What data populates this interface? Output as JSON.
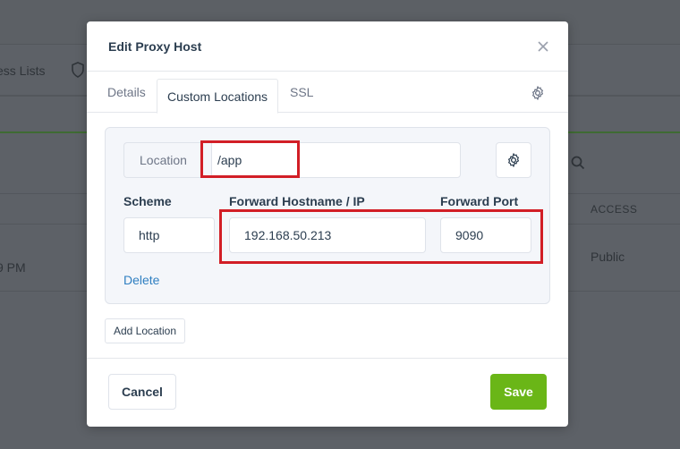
{
  "background": {
    "nav_text": "ess Lists",
    "access_header": "ACCESS",
    "access_value": "Public",
    "time_fragment": "9 PM"
  },
  "modal": {
    "title": "Edit Proxy Host",
    "tabs": [
      {
        "label": "Details"
      },
      {
        "label": "Custom Locations",
        "active": true
      },
      {
        "label": "SSL"
      }
    ],
    "location": {
      "prefix_label": "Location",
      "value": "/app"
    },
    "scheme": {
      "label": "Scheme",
      "value": "http"
    },
    "forward_host": {
      "label": "Forward Hostname / IP",
      "value": "192.168.50.213"
    },
    "forward_port": {
      "label": "Forward Port",
      "value": "9090"
    },
    "delete_label": "Delete",
    "add_location_label": "Add Location",
    "cancel_label": "Cancel",
    "save_label": "Save"
  },
  "colors": {
    "save_green": "#6ab617",
    "link_blue": "#2f7fc1",
    "annotation_red": "#d21e26",
    "overlay": "#5d6167"
  },
  "icons": [
    "close-icon",
    "gear-icon",
    "shield-icon",
    "search-icon"
  ]
}
